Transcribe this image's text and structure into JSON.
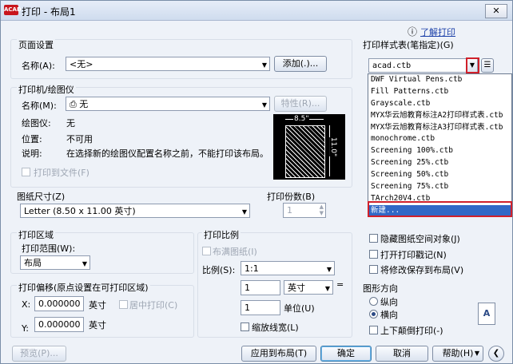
{
  "window": {
    "title": "打印 - 布局1",
    "close": "✕"
  },
  "help": {
    "icon": "ⓘ",
    "link": "了解打印"
  },
  "page_setup": {
    "group": "页面设置",
    "name_label": "名称(A):",
    "name_value": "<无>",
    "add_button": "添加(.)..."
  },
  "printer": {
    "group": "打印机/绘图仪",
    "name_label": "名称(M):",
    "name_value": "无",
    "properties_button": "特性(R)...",
    "plotter_label": "绘图仪:",
    "plotter_value": "无",
    "location_label": "位置:",
    "location_value": "不可用",
    "desc_label": "说明:",
    "desc_value": "在选择新的绘图仪配置名称之前，不能打印该布局。",
    "print_to_file": "打印到文件(F)",
    "preview_width": "8.5\"",
    "preview_height": "11.0\""
  },
  "paper": {
    "group": "图纸尺寸(Z)",
    "value": "Letter (8.50 x 11.00 英寸)"
  },
  "copies": {
    "label": "打印份数(B)",
    "value": "1"
  },
  "area": {
    "group": "打印区域",
    "range_label": "打印范围(W):",
    "range_value": "布局"
  },
  "offset": {
    "group": "打印偏移(原点设置在可打印区域)",
    "x_label": "X:",
    "x_value": "0.000000",
    "x_unit": "英寸",
    "center": "居中打印(C)",
    "y_label": "Y:",
    "y_value": "0.000000",
    "y_unit": "英寸"
  },
  "scale": {
    "group": "打印比例",
    "fit": "布满图纸(I)",
    "ratio_label": "比例(S):",
    "ratio_value": "1:1",
    "val1": "1",
    "unit_value": "英寸",
    "eq": "=",
    "val2": "1",
    "unit_label": "单位(U)",
    "lineweight": "缩放线宽(L)"
  },
  "style_table": {
    "group": "打印样式表(笔指定)(G)",
    "value": "acad.ctb",
    "items": [
      "DWF Virtual Pens.ctb",
      "Fill Patterns.ctb",
      "Grayscale.ctb",
      "MYX华云旭教育标注A2打印样式表.ctb",
      "MYX华云旭教育标注A3打印样式表.ctb",
      "monochrome.ctb",
      "Screening 100%.ctb",
      "Screening 25%.ctb",
      "Screening 50%.ctb",
      "Screening 75%.ctb",
      "TArch20V4.ctb",
      "新建..."
    ],
    "selected_index": 11
  },
  "options": {
    "hide": "隐藏图纸空间对象(J)",
    "stamp": "打开打印戳记(N)",
    "save": "将修改保存到布局(V)"
  },
  "orientation": {
    "group": "图形方向",
    "portrait": "纵向",
    "landscape": "横向",
    "upside": "上下颠倒打印(-)"
  },
  "footer": {
    "preview": "预览(P)...",
    "apply": "应用到布局(T)",
    "ok": "确定",
    "cancel": "取消",
    "help": "帮助(H)"
  },
  "colors": {
    "accent": "#3168c6",
    "highlight": "#d0202a"
  }
}
